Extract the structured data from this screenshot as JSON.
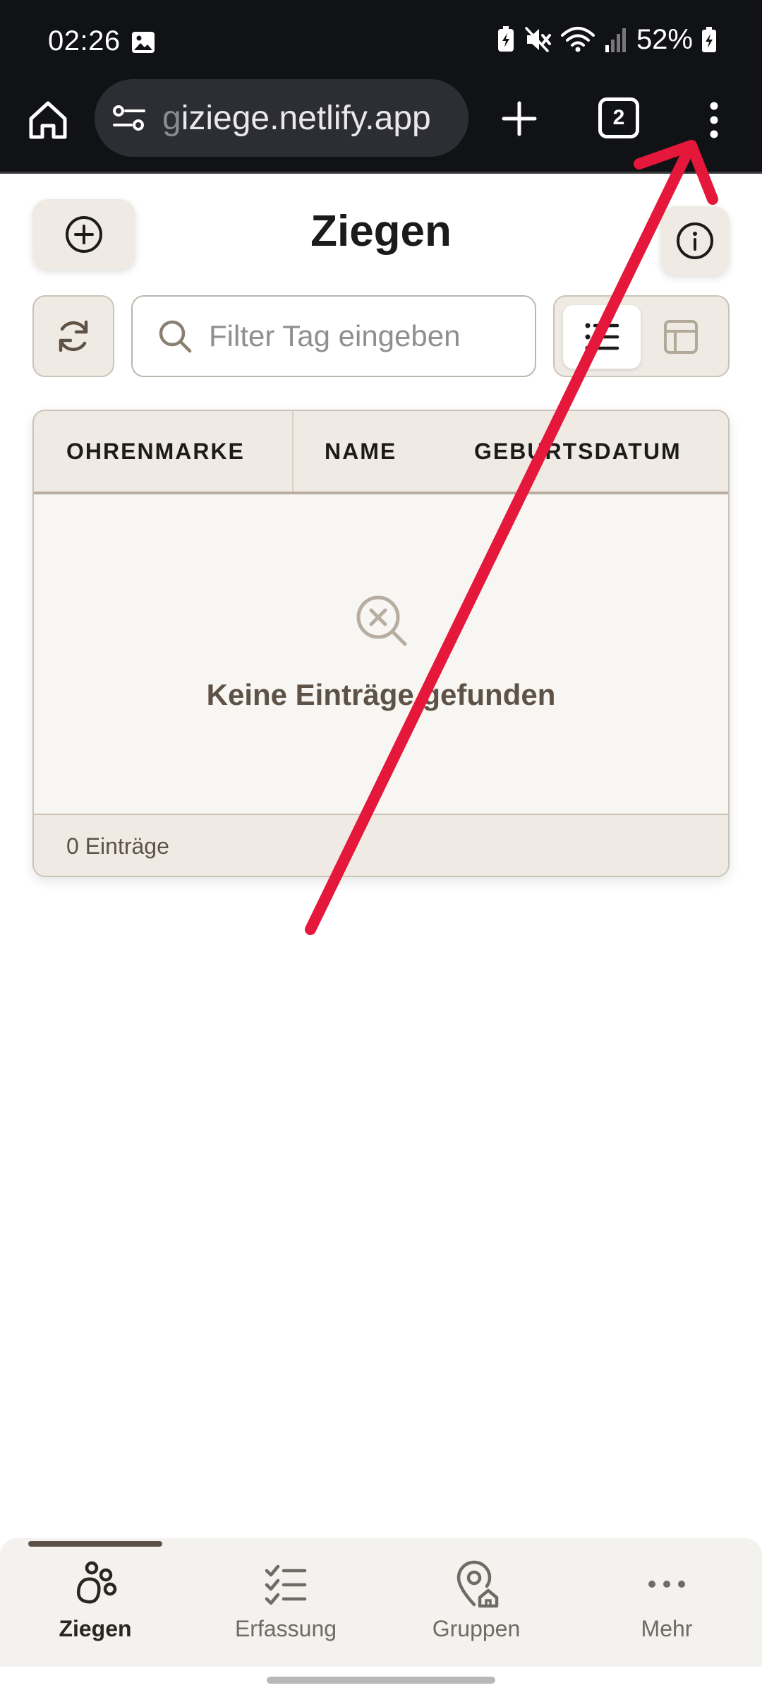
{
  "status_bar": {
    "time": "02:26",
    "battery": "52%"
  },
  "browser": {
    "url_faint": "g",
    "url_main": "iziege.netlify.app",
    "tab_count": "2"
  },
  "page": {
    "title": "Ziegen",
    "search_placeholder": "Filter Tag eingeben"
  },
  "table": {
    "columns": [
      "OHRENMARKE",
      "NAME",
      "GEBURTSDATUM"
    ],
    "empty_message": "Keine Einträge gefunden",
    "footer_count": "0 Einträge"
  },
  "bottom_nav": {
    "items": [
      {
        "label": "Ziegen",
        "icon": "goat-paw-icon",
        "active": true
      },
      {
        "label": "Erfassung",
        "icon": "checklist-icon",
        "active": false
      },
      {
        "label": "Gruppen",
        "icon": "location-home-icon",
        "active": false
      },
      {
        "label": "Mehr",
        "icon": "more-horizontal-icon",
        "active": false
      }
    ]
  },
  "colors": {
    "chrome_dark": "#111216",
    "accent_brown": "#5e5145",
    "surface_beige": "#efebe4",
    "annotation_red": "#e5173a"
  }
}
